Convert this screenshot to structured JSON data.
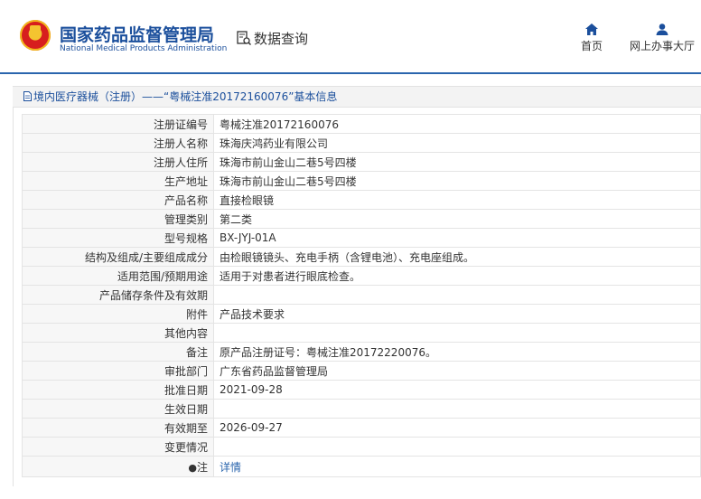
{
  "header": {
    "logo_cn": "国家药品监督管理局",
    "logo_en": "National Medical Products Administration",
    "data_query": "数据查询",
    "nav": [
      {
        "label": "首页",
        "icon": "home-icon"
      },
      {
        "label": "网上办事大厅",
        "icon": "user-icon"
      }
    ]
  },
  "breadcrumb": "境内医疗器械（注册）——“粤械注准20172160076”基本信息",
  "rows": [
    {
      "key": "注册证编号",
      "value": "粤械注准20172160076"
    },
    {
      "key": "注册人名称",
      "value": "珠海庆鸿药业有限公司"
    },
    {
      "key": "注册人住所",
      "value": "珠海市前山金山二巷5号四楼"
    },
    {
      "key": "生产地址",
      "value": "珠海市前山金山二巷5号四楼"
    },
    {
      "key": "产品名称",
      "value": "直接检眼镜"
    },
    {
      "key": "管理类别",
      "value": "第二类"
    },
    {
      "key": "型号规格",
      "value": "BX-JYJ-01A"
    },
    {
      "key": "结构及组成/主要组成成分",
      "value": "由检眼镜镜头、充电手柄（含锂电池）、充电座组成。"
    },
    {
      "key": "适用范围/预期用途",
      "value": "适用于对患者进行眼底检查。"
    },
    {
      "key": "产品储存条件及有效期",
      "value": ""
    },
    {
      "key": "附件",
      "value": "产品技术要求"
    },
    {
      "key": "其他内容",
      "value": ""
    },
    {
      "key": "备注",
      "value": "原产品注册证号：粤械注准20172220076。"
    },
    {
      "key": "审批部门",
      "value": "广东省药品监督管理局"
    },
    {
      "key": "批准日期",
      "value": "2021-09-28"
    },
    {
      "key": "生效日期",
      "value": ""
    },
    {
      "key": "有效期至",
      "value": "2026-09-27"
    },
    {
      "key": "变更情况",
      "value": ""
    }
  ],
  "note": {
    "key": "注",
    "icon": "pin-icon",
    "link": "详情"
  },
  "colors": {
    "brand_blue": "#1b4f9c",
    "link_blue": "#2a65ad",
    "emblem_red": "#d71e1e"
  }
}
